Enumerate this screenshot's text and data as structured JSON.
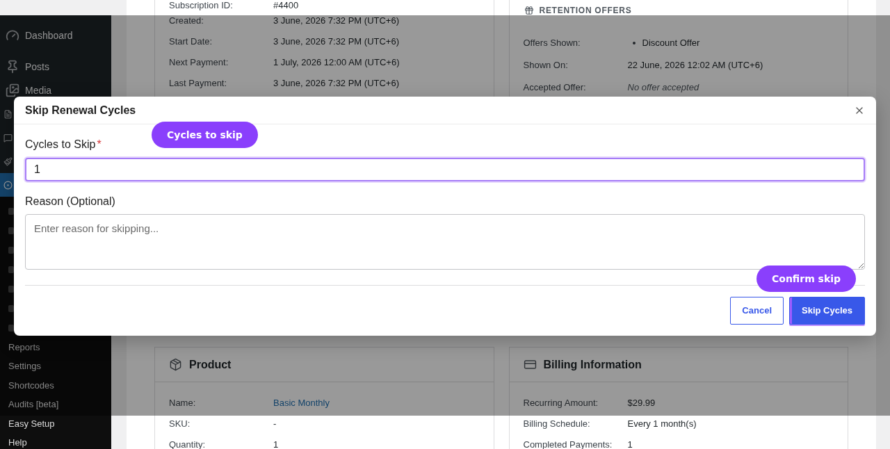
{
  "sidebar": {
    "items": [
      {
        "label": "Dashboard",
        "selected": false
      },
      {
        "label": "Posts",
        "selected": false
      },
      {
        "label": "Media",
        "selected": false
      },
      {
        "selected": false
      },
      {
        "selected": false
      },
      {
        "selected": false
      },
      {
        "selected": true
      }
    ],
    "submenu": [
      {
        "kind": "stub"
      },
      {
        "kind": "stub"
      },
      {
        "kind": "stub"
      },
      {
        "kind": "stub"
      },
      {
        "kind": "stub"
      },
      {
        "kind": "stub"
      },
      {
        "kind": "stub"
      },
      {
        "kind": "text",
        "label": "Reports"
      },
      {
        "kind": "text",
        "label": "Settings"
      },
      {
        "kind": "text",
        "label": "Shortcodes"
      },
      {
        "kind": "text",
        "label": "Audits [beta]"
      },
      {
        "kind": "text",
        "label": "Easy Setup"
      },
      {
        "kind": "text",
        "label": "Help"
      }
    ]
  },
  "subscription_details": {
    "rows": [
      {
        "label": "Subscription ID:",
        "kind": "text",
        "value": "#4400"
      },
      {
        "label": "Created:",
        "kind": "text",
        "value": "3 June, 2026 7:32 PM (UTC+6)"
      },
      {
        "label": "Start Date:",
        "kind": "text",
        "value": "3 June, 2026 7:32 PM (UTC+6)"
      },
      {
        "label": "Next Payment:",
        "kind": "text",
        "value": "1 July, 2026 12:00 AM (UTC+6)"
      },
      {
        "label": "Last Payment:",
        "kind": "text",
        "value": "3 June, 2026 7:32 PM (UTC+6)"
      }
    ]
  },
  "retention_offers": {
    "title": "RETENTION OFFERS",
    "rows": [
      {
        "label": "Offers Shown:",
        "kind": "list",
        "items": [
          "Discount Offer"
        ]
      },
      {
        "label": "Shown On:",
        "kind": "text",
        "value": "22 June, 2026 12:02 AM (UTC+6)"
      },
      {
        "label": "Accepted Offer:",
        "kind": "empty",
        "value": "No offer accepted"
      }
    ]
  },
  "product": {
    "title": "Product",
    "rows": [
      {
        "label": "Name:",
        "kind": "link",
        "value": "Basic Monthly"
      },
      {
        "label": "SKU:",
        "kind": "text",
        "value": "-"
      },
      {
        "label": "Quantity:",
        "kind": "text",
        "value": "1"
      }
    ]
  },
  "billing_information": {
    "title": "Billing Information",
    "rows": [
      {
        "label": "Recurring Amount:",
        "kind": "text",
        "value": "$29.99"
      },
      {
        "label": "Billing Schedule:",
        "kind": "text",
        "value": "Every 1 month(s)"
      },
      {
        "label": "Completed Payments:",
        "kind": "text",
        "value": "1"
      }
    ]
  },
  "dialog": {
    "title": "Skip Renewal Cycles",
    "fields": [
      {
        "kind": "input",
        "label": "Cycles to Skip",
        "required_mark": "*",
        "value": "1",
        "highlighted": true
      },
      {
        "kind": "textarea",
        "label": "Reason (Optional)",
        "placeholder": "Enter reason for skipping...",
        "highlighted": false
      }
    ],
    "buttons": [
      {
        "label": "Cancel",
        "kind": "secondary",
        "highlighted": false
      },
      {
        "label": "Skip Cycles",
        "kind": "primary",
        "highlighted": true
      }
    ]
  },
  "annotations": [
    {
      "text": "Cycles to skip"
    },
    {
      "text": "Confirm skip"
    }
  ]
}
